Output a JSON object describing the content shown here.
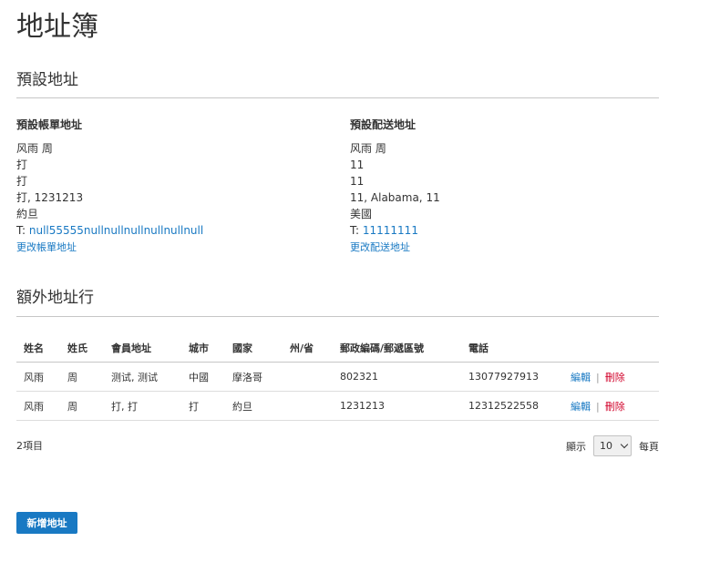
{
  "page_title": "地址簿",
  "default_section": {
    "title": "預設地址",
    "billing": {
      "heading": "預設帳單地址",
      "name": "风雨 周",
      "lines": [
        "打",
        "打",
        "打, 1231213",
        "約旦"
      ],
      "phone_prefix": "T: ",
      "phone": "null55555nullnullnullnullnullnull",
      "change_link": "更改帳單地址"
    },
    "shipping": {
      "heading": "預設配送地址",
      "name": "风雨 周",
      "lines": [
        "11",
        "11",
        "11, Alabama, 11",
        "美國"
      ],
      "phone_prefix": "T: ",
      "phone": "11111111",
      "change_link": "更改配送地址"
    }
  },
  "additional_section": {
    "title": "額外地址行",
    "columns": [
      "姓名",
      "姓氏",
      "會員地址",
      "城市",
      "國家",
      "州/省",
      "郵政編碼/郵遞區號",
      "電話"
    ],
    "rows": [
      {
        "first": "风雨",
        "last": "周",
        "street": "测试, 测试",
        "city": "中國",
        "country": "摩洛哥",
        "state": "",
        "zip": "802321",
        "phone": "13077927913",
        "edit": "編輯",
        "delete": "刪除"
      },
      {
        "first": "风雨",
        "last": "周",
        "street": "打, 打",
        "city": "打",
        "country": "約旦",
        "state": "",
        "zip": "1231213",
        "phone": "12312522558",
        "edit": "編輯",
        "delete": "刪除"
      }
    ],
    "separator": "|",
    "items_count": "2項目",
    "pager": {
      "show_label": "顯示",
      "page_size": "10",
      "per_page_label": "每頁"
    }
  },
  "add_button": "新增地址",
  "colors": {
    "link": "#1979c3",
    "delete": "#d10029",
    "button": "#1979c3"
  }
}
